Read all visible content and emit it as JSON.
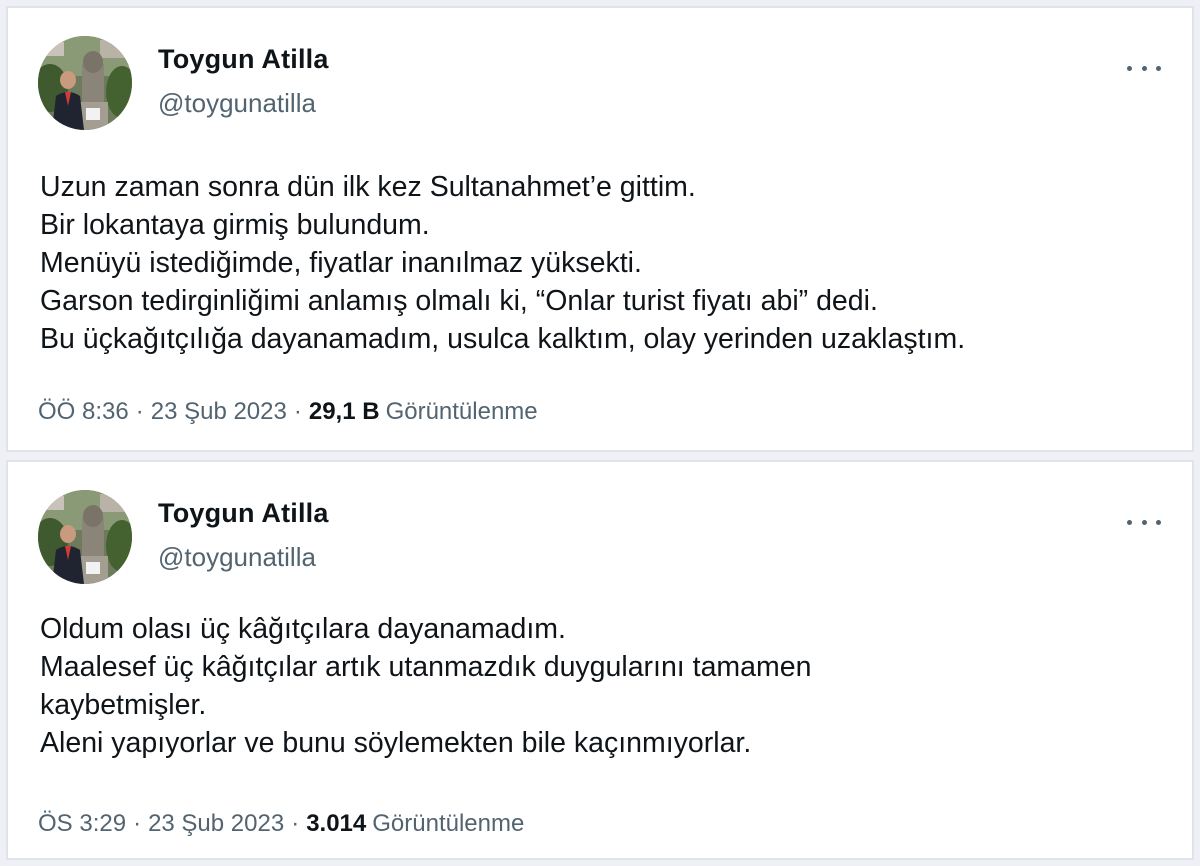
{
  "tweets": [
    {
      "author": {
        "display_name": "Toygun Atilla",
        "handle": "@toygunatilla",
        "avatar_icon": "profile-photo"
      },
      "more_icon": "more-options-icon",
      "text_lines": [
        "Uzun zaman sonra dün ilk kez Sultanahmet’e gittim.",
        "Bir lokantaya girmiş bulundum.",
        "Menüyü istediğimde, fiyatlar inanılmaz yüksekti.",
        "Garson tedirginliğimi anlamış olmalı ki, “Onlar turist fiyatı abi” dedi.",
        "Bu üçkağıtçılığa dayanamadım, usulca kalktım, olay yerinden uzaklaştım."
      ],
      "time": "ÖÖ 8:36",
      "date": "23 Şub 2023",
      "separator": "·",
      "views_count": "29,1 B",
      "views_label": "Görüntülenme"
    },
    {
      "author": {
        "display_name": "Toygun Atilla",
        "handle": "@toygunatilla",
        "avatar_icon": "profile-photo"
      },
      "more_icon": "more-options-icon",
      "text_lines": [
        "Oldum olası üç kâğıtçılara dayanamadım.",
        "Maalesef üç kâğıtçılar artık utanmazdık duygularını tamamen",
        "kaybetmişler.",
        "Aleni yapıyorlar ve bunu söylemekten bile kaçınmıyorlar."
      ],
      "time": "ÖS 3:29",
      "date": "23 Şub 2023",
      "separator": "·",
      "views_count": "3.014",
      "views_label": "Görüntülenme"
    }
  ]
}
